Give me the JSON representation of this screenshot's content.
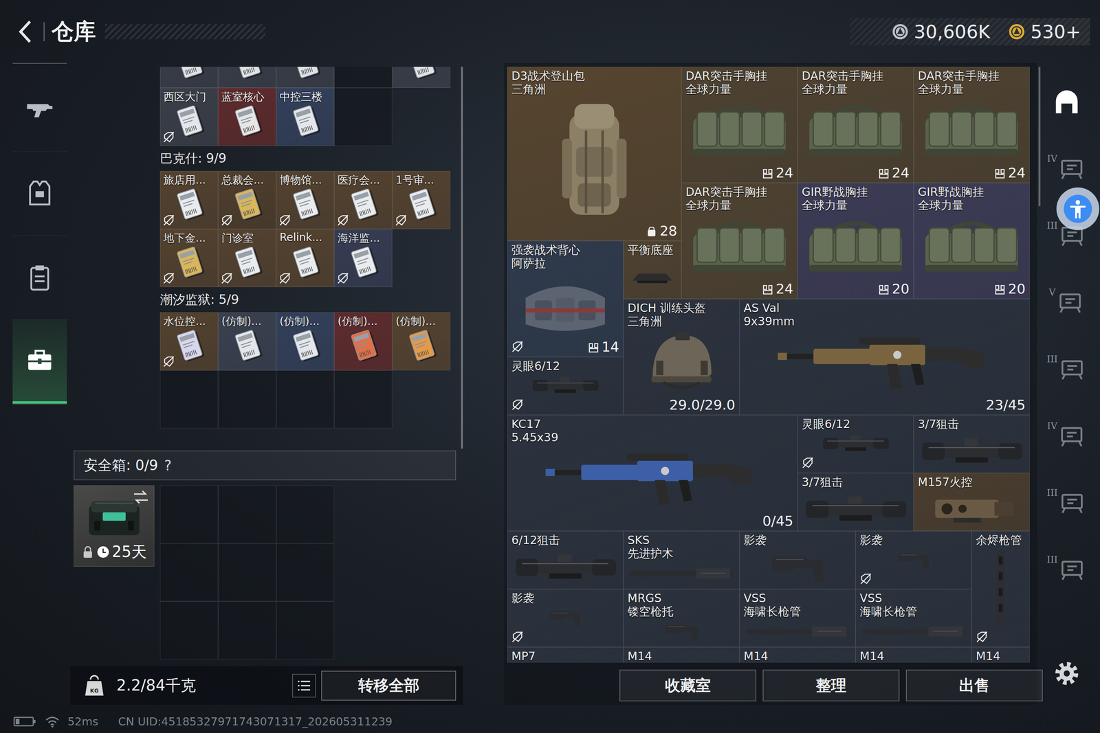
{
  "header": {
    "title": "仓库",
    "currencies": [
      {
        "value": "30,606K",
        "color": "#b9c1c9"
      },
      {
        "value": "530+",
        "color": "#d8ac34"
      }
    ]
  },
  "nav": {
    "items": [
      {
        "selected": false
      },
      {
        "selected": false
      },
      {
        "selected": false
      },
      {
        "selected": true
      }
    ]
  },
  "keys": {
    "clipped_row": [
      {
        "kind": "card",
        "color": "#3a3f4a",
        "tint": "#dfe3e8",
        "untagged": false
      },
      {
        "kind": "card",
        "color": "#3a3f4a",
        "tint": "#dfe3e8",
        "untagged": false
      },
      {
        "kind": "card",
        "color": "#3a3f4a",
        "tint": "#dfe3e8",
        "untagged": false
      },
      {
        "kind": "empty"
      },
      {
        "kind": "card",
        "color": "#3a3f4a",
        "tint": "#dfe3e8",
        "untagged": false
      }
    ],
    "sections": [
      {
        "cells": [
          {
            "kind": "card",
            "label": "西区大门",
            "color": "#3a3f49",
            "tint": "#e3e6ea",
            "untagged": true
          },
          {
            "kind": "card",
            "label": "蓝室核心",
            "color": "#5e2b2d",
            "tint": "#e6e6e6",
            "untagged": false
          },
          {
            "kind": "card",
            "label": "中控三楼",
            "color": "#33405a",
            "tint": "#e3e6ea",
            "untagged": false
          },
          {
            "kind": "empty"
          }
        ]
      },
      {
        "title": "巴克什: 9/9",
        "cells": [
          {
            "kind": "card",
            "label": "旅店用...",
            "color": "#54422f",
            "tint": "#e8ecef",
            "untagged": true
          },
          {
            "kind": "card",
            "label": "总裁会...",
            "color": "#4f3e2c",
            "tint": "#d9b65a",
            "untagged": true
          },
          {
            "kind": "card",
            "label": "博物馆...",
            "color": "#54422f",
            "tint": "#e8ecef",
            "untagged": true
          },
          {
            "kind": "card",
            "label": "医疗会...",
            "color": "#54422f",
            "tint": "#e8ecef",
            "untagged": true
          },
          {
            "kind": "card",
            "label": "1号审...",
            "color": "#54422f",
            "tint": "#e8ecef",
            "untagged": true
          },
          {
            "kind": "card",
            "label": "地下金...",
            "color": "#54422f",
            "tint": "#d9b65a",
            "untagged": true
          },
          {
            "kind": "card",
            "label": "门诊室",
            "color": "#54422f",
            "tint": "#e8ecef",
            "untagged": true
          },
          {
            "kind": "card",
            "label": "Relink...",
            "color": "#54422f",
            "tint": "#e8ecef",
            "untagged": true
          },
          {
            "kind": "card",
            "label": "海洋监...",
            "color": "#363c52",
            "tint": "#e8ecef",
            "untagged": true
          }
        ]
      },
      {
        "title": "潮汐监狱: 5/9",
        "cells": [
          {
            "kind": "card",
            "label": "水位控...",
            "color": "#54422f",
            "tint": "#d8d6ee",
            "untagged": true
          },
          {
            "kind": "card",
            "label": "(仿制)...",
            "color": "#3a4150",
            "tint": "#e3e6ea",
            "untagged": false
          },
          {
            "kind": "card",
            "label": "(仿制)...",
            "color": "#33405a",
            "tint": "#e3e6ea",
            "untagged": false
          },
          {
            "kind": "card",
            "label": "(仿制)...",
            "color": "#5e2b2d",
            "tint": "#e0704a",
            "untagged": false
          },
          {
            "kind": "card",
            "label": "(仿制)...",
            "color": "#54422f",
            "tint": "#e39a4a",
            "untagged": false
          },
          {
            "kind": "empty"
          },
          {
            "kind": "empty"
          },
          {
            "kind": "empty"
          },
          {
            "kind": "empty"
          }
        ]
      }
    ]
  },
  "safe_box": {
    "title": "安全箱: 0/9",
    "help": "?",
    "days": "25天",
    "slots": 9
  },
  "footer_left": {
    "weight_icon_text": "KG",
    "weight": "2.2/84千克",
    "transfer": "转移全部"
  },
  "stash": {
    "items": [
      {
        "kind": "backpack",
        "name": "D3战术登山包",
        "sub": "三角洲",
        "count": "28",
        "color": "#56452f",
        "untagged": false
      },
      {
        "kind": "rig",
        "name": "DAR突击手胸挂",
        "sub": "全球力量",
        "count": "24",
        "color": "#4e4231",
        "untagged": false
      },
      {
        "kind": "rig",
        "name": "DAR突击手胸挂",
        "sub": "全球力量",
        "count": "24",
        "color": "#4e4231",
        "untagged": false
      },
      {
        "kind": "rig",
        "name": "DAR突击手胸挂",
        "sub": "全球力量",
        "count": "24",
        "color": "#4e4231",
        "untagged": false
      },
      {
        "kind": "rig",
        "name": "DAR突击手胸挂",
        "sub": "全球力量",
        "count": "24",
        "color": "#4e4231",
        "untagged": false
      },
      {
        "kind": "rig",
        "name": "GIR野战胸挂",
        "sub": "全球力量",
        "count": "20",
        "color": "#3c3b55",
        "untagged": false
      },
      {
        "kind": "rig",
        "name": "GIR野战胸挂",
        "sub": "全球力量",
        "count": "20",
        "color": "#3c3b55",
        "untagged": false
      },
      {
        "kind": "vest",
        "name": "强袭战术背心",
        "sub": "阿萨拉",
        "count": "14",
        "color": "#2f3a4c",
        "untagged": true
      },
      {
        "kind": "mount",
        "name": "平衡底座",
        "color": "#4e4231",
        "untagged": false
      },
      {
        "kind": "helmet",
        "name": "DICH 训练头盔",
        "sub": "三角洲",
        "count": "29.0/29.0",
        "color": "#2c323d",
        "untagged": false
      },
      {
        "kind": "rifle",
        "name": "AS Val",
        "sub": "9x39mm",
        "count": "23/45",
        "color": "#2b323d",
        "accent": "#7a6440",
        "untagged": false
      },
      {
        "kind": "scope",
        "name": "灵眼6/12",
        "color": "#2b323d",
        "untagged": true
      },
      {
        "kind": "rifle",
        "name": "KC17",
        "sub": "5.45x39",
        "count": "0/45",
        "color": "#2b323d",
        "accent": "#3d5fa8",
        "untagged": false
      },
      {
        "kind": "scope",
        "name": "灵眼6/12",
        "color": "#2b323d",
        "untagged": true
      },
      {
        "kind": "scope",
        "name": "3/7狙击",
        "color": "#2b323d",
        "untagged": false
      },
      {
        "kind": "scope",
        "name": "3/7狙击",
        "color": "#2b323d",
        "untagged": false
      },
      {
        "kind": "firecontrol",
        "name": "M157火控",
        "color": "#4a3d2f",
        "untagged": false
      },
      {
        "kind": "scope",
        "name": "6/12狙击",
        "color": "#2b323d",
        "untagged": false
      },
      {
        "kind": "barrel",
        "name": "SKS",
        "sub": "先进护木",
        "color": "#2b323d",
        "untagged": false
      },
      {
        "kind": "stock",
        "name": "影袭",
        "color": "#2b323d",
        "untagged": false
      },
      {
        "kind": "stock",
        "name": "影袭",
        "color": "#2b323d",
        "untagged": true
      },
      {
        "kind": "handguard",
        "name": "余烬枪管",
        "color": "#2b323d",
        "untagged": true
      },
      {
        "kind": "stock",
        "name": "影袭",
        "color": "#2b323d",
        "untagged": true
      },
      {
        "kind": "stock",
        "name": "MRGS",
        "sub": "镂空枪托",
        "color": "#2b323d",
        "untagged": false
      },
      {
        "kind": "barrel",
        "name": "VSS",
        "sub": "海啸长枪管",
        "color": "#2b323d",
        "untagged": false
      },
      {
        "kind": "barrel",
        "name": "VSS",
        "sub": "海啸长枪管",
        "color": "#2b323d",
        "untagged": false
      },
      {
        "kind": "rifle",
        "name": "MP7",
        "color": "#2b323d",
        "accent": "#3a3d42",
        "untagged": false
      },
      {
        "kind": "rifle",
        "name": "M14",
        "color": "#2b323d",
        "accent": "#5a4632",
        "untagged": false
      },
      {
        "kind": "rifle",
        "name": "M14",
        "color": "#2b323d",
        "accent": "#5a4632",
        "untagged": false
      },
      {
        "kind": "rifle",
        "name": "M14",
        "color": "#2b323d",
        "accent": "#5a4632",
        "untagged": false
      },
      {
        "kind": "rifle",
        "name": "M14",
        "color": "#2b323d",
        "accent": "#5a4632",
        "untagged": false
      }
    ]
  },
  "actions": [
    "收藏室",
    "整理",
    "出售"
  ],
  "side_tabs": [
    {
      "selected": true
    },
    {
      "badge": "IV",
      "selected": false
    },
    {
      "badge": "III",
      "selected": false
    },
    {
      "badge": "V",
      "selected": false
    },
    {
      "badge": "III",
      "selected": false
    },
    {
      "badge": "IV",
      "selected": false
    },
    {
      "badge": "III",
      "selected": false
    },
    {
      "badge": "III",
      "selected": false
    }
  ],
  "status_bar": {
    "ping": "52ms",
    "uid": "CN UID:45185327971743071317_202605311239"
  }
}
